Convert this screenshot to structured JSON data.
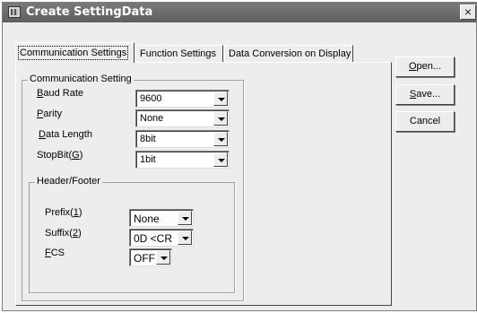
{
  "window": {
    "title": "Create SettingData",
    "close_glyph": "×"
  },
  "tabs": [
    {
      "label": "Communication Settings",
      "active": true
    },
    {
      "label": "Function Settings",
      "active": false
    },
    {
      "label": "Data Conversion on Display",
      "active": false
    }
  ],
  "communication": {
    "group_title": "Communication Setting",
    "baud_rate": {
      "label_mnemonic": "B",
      "label_rest": "aud Rate",
      "value": "9600"
    },
    "parity": {
      "label_mnemonic": "P",
      "label_rest": "arity",
      "value": "None"
    },
    "data_length": {
      "label_mnemonic": "D",
      "label_rest": "ata Length",
      "value": "8bit"
    },
    "stop_bit": {
      "label_text": "StopBit(",
      "label_mnemonic": "G",
      "label_close": ")",
      "value": "1bit"
    }
  },
  "header_footer": {
    "group_title": "Header/Footer",
    "prefix": {
      "label_text": "Prefix(",
      "label_mnemonic": "1",
      "label_close": ")",
      "value": "None"
    },
    "suffix": {
      "label_text": "Suffix(",
      "label_mnemonic": "2",
      "label_close": ")",
      "value": "0D <CR"
    },
    "fcs": {
      "label_mnemonic": "F",
      "label_rest": "CS",
      "value": "OFF"
    }
  },
  "buttons": {
    "open": {
      "mnemonic": "O",
      "rest": "pen..."
    },
    "save": {
      "mnemonic": "S",
      "rest": "ave..."
    },
    "cancel": {
      "label": "Cancel"
    }
  }
}
